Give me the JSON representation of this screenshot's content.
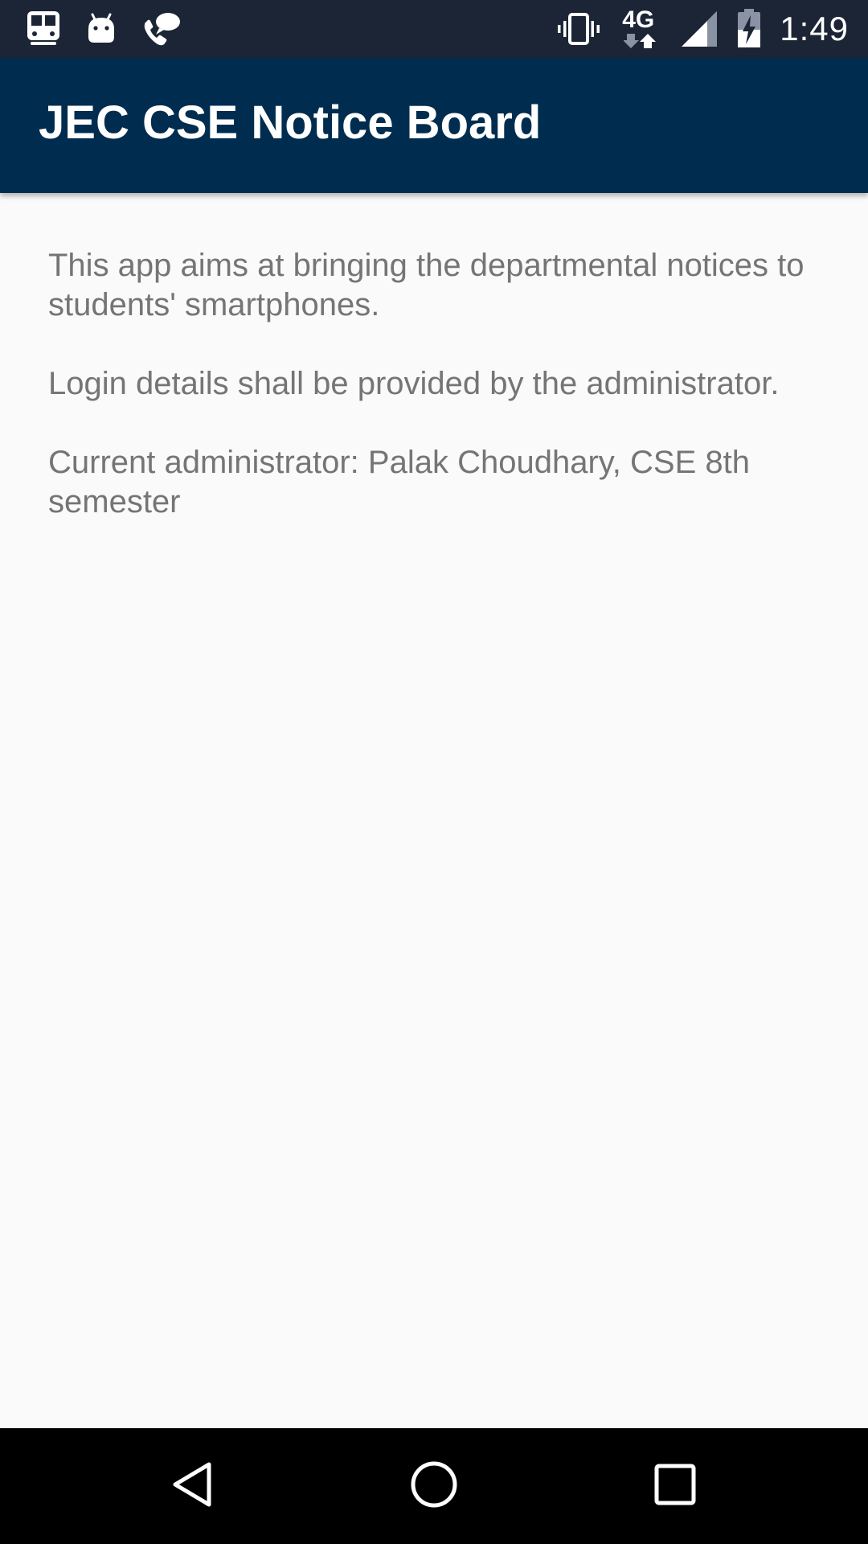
{
  "status_bar": {
    "time": "1:49",
    "network_type": "4G",
    "left_icons": [
      "train-icon",
      "android-icon",
      "phone-chat-icon"
    ],
    "right_icons": [
      "vibrate-icon",
      "network-4g-icon",
      "signal-icon",
      "battery-charging-icon"
    ],
    "background_color": "#1c2536"
  },
  "app_bar": {
    "title": "JEC CSE Notice Board",
    "background_color": "#002d4f"
  },
  "content": {
    "paragraphs": [
      "This app aims at bringing the departmental notices to students' smartphones.",
      "Login details shall be provided by the administrator.",
      "Current administrator: Palak Choudhary, CSE 8th semester"
    ],
    "text_color": "#757575"
  },
  "nav_bar": {
    "buttons": [
      "back-icon",
      "home-icon",
      "recents-icon"
    ]
  }
}
